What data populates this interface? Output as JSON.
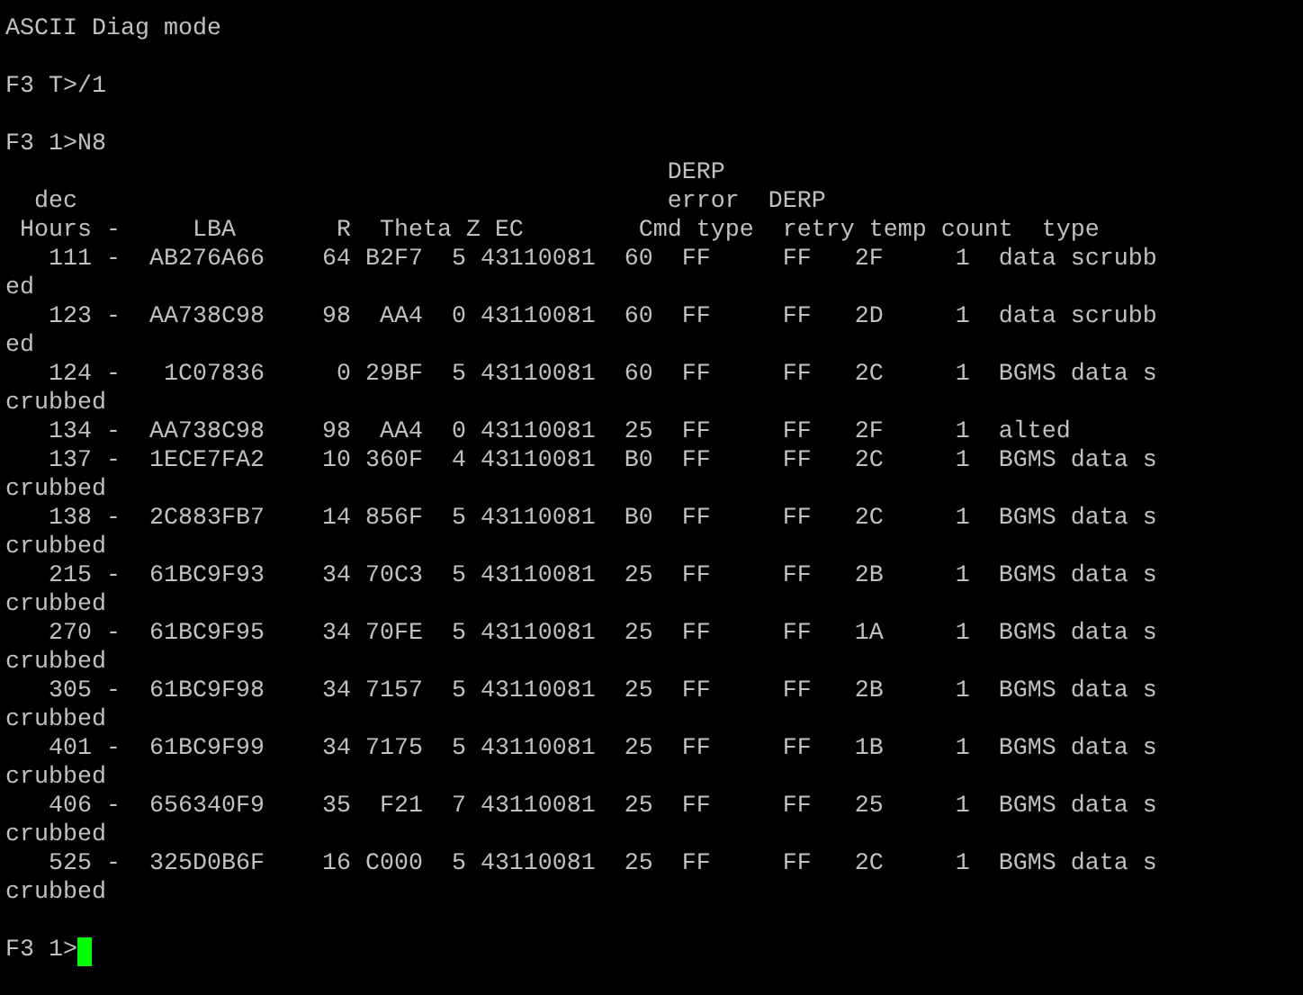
{
  "terminal": {
    "blocks": [
      [
        "ASCII Diag mode"
      ],
      [
        "F3 T>/1"
      ],
      [
        "F3 1>N8",
        "                                              DERP",
        "  dec                                         error  DERP",
        " Hours -     LBA       R  Theta Z EC        Cmd type  retry temp count  type",
        "   111 -  AB276A66    64 B2F7  5 43110081  60  FF     FF   2F     1  data scrubb",
        "ed",
        "   123 -  AA738C98    98  AA4  0 43110081  60  FF     FF   2D     1  data scrubb",
        "ed",
        "   124 -   1C07836     0 29BF  5 43110081  60  FF     FF   2C     1  BGMS data s",
        "crubbed",
        "   134 -  AA738C98    98  AA4  0 43110081  25  FF     FF   2F     1  alted",
        "   137 -  1ECE7FA2    10 360F  4 43110081  B0  FF     FF   2C     1  BGMS data s",
        "crubbed",
        "   138 -  2C883FB7    14 856F  5 43110081  B0  FF     FF   2C     1  BGMS data s",
        "crubbed",
        "   215 -  61BC9F93    34 70C3  5 43110081  25  FF     FF   2B     1  BGMS data s",
        "crubbed",
        "   270 -  61BC9F95    34 70FE  5 43110081  25  FF     FF   1A     1  BGMS data s",
        "crubbed",
        "   305 -  61BC9F98    34 7157  5 43110081  25  FF     FF   2B     1  BGMS data s",
        "crubbed",
        "   401 -  61BC9F99    34 7175  5 43110081  25  FF     FF   1B     1  BGMS data s",
        "crubbed",
        "   406 -  656340F9    35  F21  7 43110081  25  FF     FF   25     1  BGMS data s",
        "crubbed",
        "   525 -  325D0B6F    16 C000  5 43110081  25  FF     FF   2C     1  BGMS data s",
        "crubbed"
      ]
    ],
    "prompt": {
      "text": "F3 1>",
      "cursor": true
    }
  }
}
